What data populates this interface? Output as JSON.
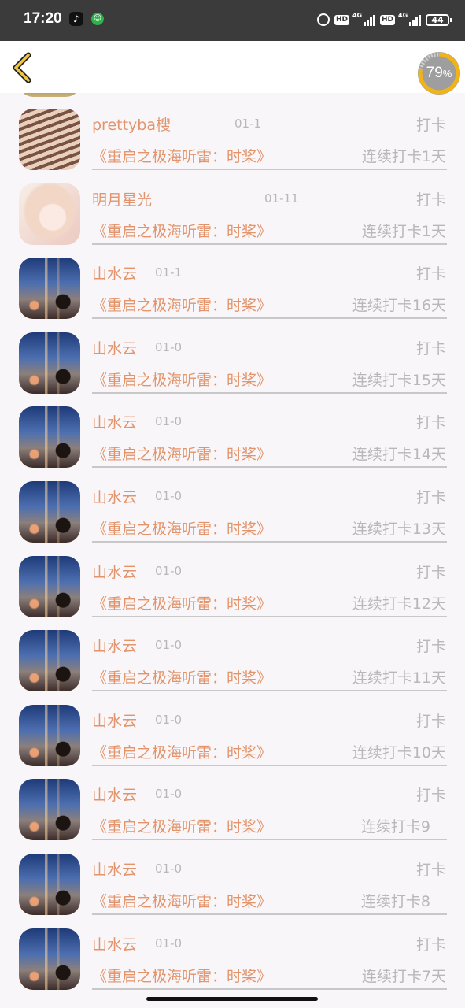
{
  "status_bar": {
    "time": "17:20",
    "hd1": "HD",
    "hd2": "HD",
    "net1": "4G",
    "net2": "4G",
    "battery": "44"
  },
  "header": {
    "progress_value": "79",
    "progress_unit": "%",
    "progress_fraction": 0.79,
    "accent_color": "#f2b318"
  },
  "colors": {
    "name_text": "#e3946b",
    "muted_text": "#b8b8b8"
  },
  "records": [
    {
      "user": "prettyba㮴",
      "date": "01-1",
      "label": "打卡",
      "book": "《重启之极海听雷：时桨》",
      "streak": "连续打卡1天",
      "avatar": "stairs-photo"
    },
    {
      "user": "明月星光",
      "date": "01-11",
      "label": "打卡",
      "book": "《重启之极海听雷：时桨》",
      "streak": "连续打卡1天",
      "avatar": "anime-girl"
    },
    {
      "user": "山水云",
      "date": "01-1",
      "label": "打卡",
      "book": "《重启之极海听雷：时桨》",
      "streak": "连续打卡16天",
      "avatar": "night-city"
    },
    {
      "user": "山水云",
      "date": "01-0",
      "label": "打卡",
      "book": "《重启之极海听雷：时桨》",
      "streak": "连续打卡15天",
      "avatar": "night-city"
    },
    {
      "user": "山水云",
      "date": "01-0",
      "label": "打卡",
      "book": "《重启之极海听雷：时桨》",
      "streak": "连续打卡14天",
      "avatar": "night-city"
    },
    {
      "user": "山水云",
      "date": "01-0",
      "label": "打卡",
      "book": "《重启之极海听雷：时桨》",
      "streak": "连续打卡13天",
      "avatar": "night-city"
    },
    {
      "user": "山水云",
      "date": "01-0",
      "label": "打卡",
      "book": "《重启之极海听雷：时桨》",
      "streak": "连续打卡12天",
      "avatar": "night-city"
    },
    {
      "user": "山水云",
      "date": "01-0",
      "label": "打卡",
      "book": "《重启之极海听雷：时桨》",
      "streak": "连续打卡11天",
      "avatar": "night-city"
    },
    {
      "user": "山水云",
      "date": "01-0",
      "label": "打卡",
      "book": "《重启之极海听雷：时桨》",
      "streak": "连续打卡10天",
      "avatar": "night-city"
    },
    {
      "user": "山水云",
      "date": "01-0",
      "label": "打卡",
      "book": "《重启之极海听雷：时桨》",
      "streak": "连续打卡9",
      "avatar": "night-city"
    },
    {
      "user": "山水云",
      "date": "01-0",
      "label": "打卡",
      "book": "《重启之极海听雷：时桨》",
      "streak": "连续打卡8",
      "avatar": "night-city"
    },
    {
      "user": "山水云",
      "date": "01-0",
      "label": "打卡",
      "book": "《重启之极海听雷：时桨》",
      "streak": "连续打卡7天",
      "avatar": "night-city"
    }
  ]
}
